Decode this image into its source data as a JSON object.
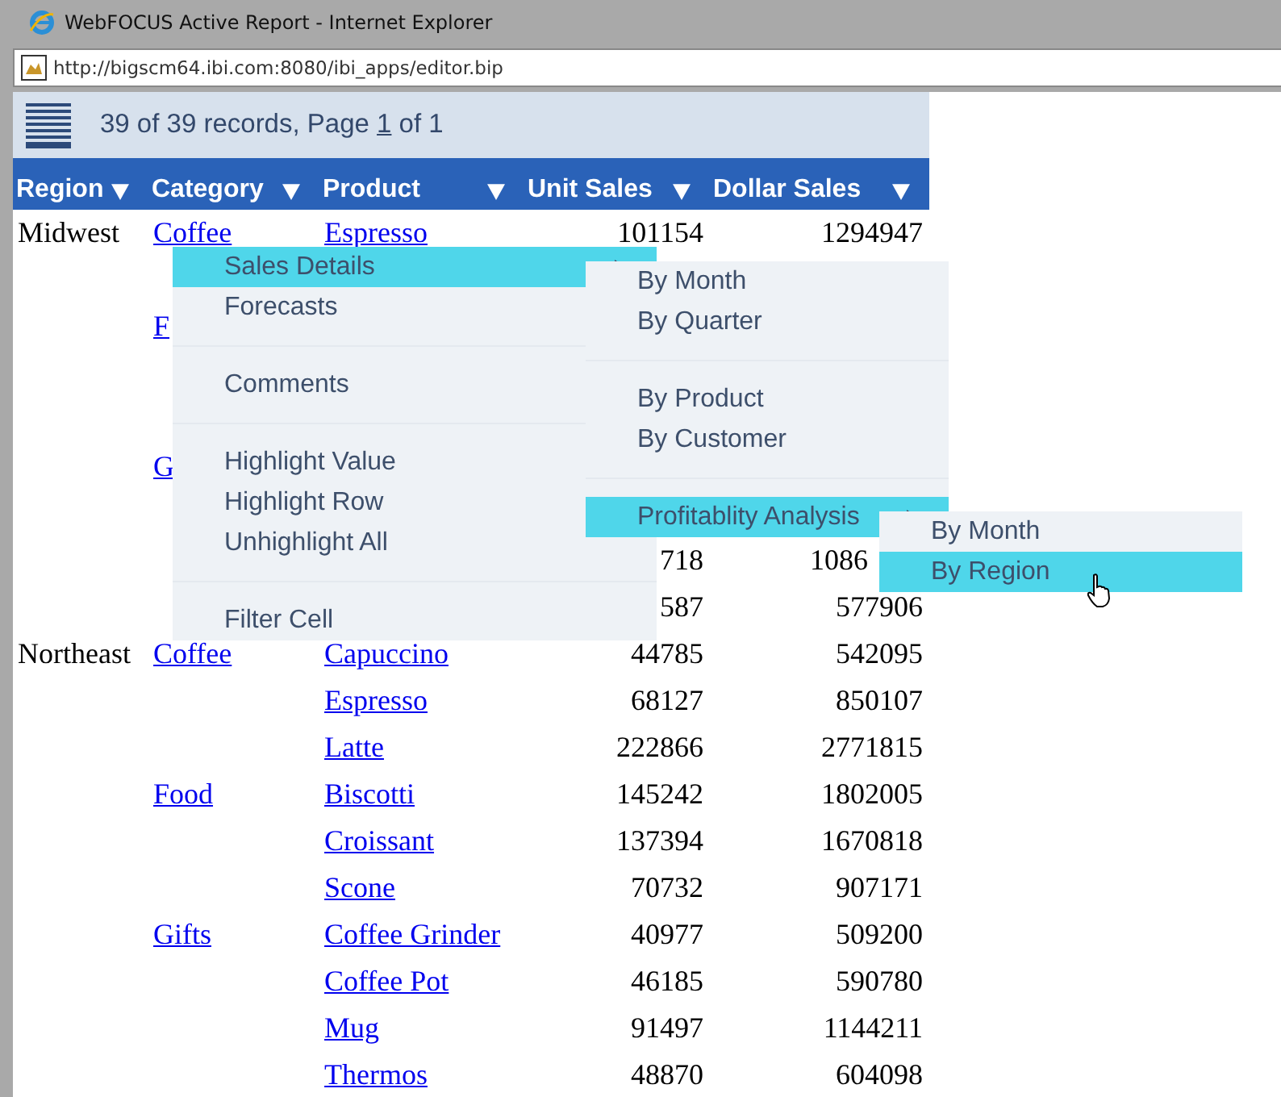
{
  "window": {
    "title": "WebFOCUS Active Report - Internet Explorer",
    "address": "http://bigscm64.ibi.com:8080/ibi_apps/editor.bip"
  },
  "toolbar": {
    "status_parts": [
      "39 of 39 records, Page ",
      "1",
      " of 1"
    ]
  },
  "table": {
    "columns": [
      "Region",
      "Category",
      "Product",
      "Unit Sales",
      "Dollar Sales"
    ],
    "rows": [
      {
        "region": "Midwest",
        "category": "Coffee",
        "product": "Espresso",
        "unit_sales": "101154",
        "dollar_sales": "1294947"
      },
      {},
      {
        "category": "F"
      },
      {},
      {},
      {
        "category": "G"
      },
      {},
      {
        "unit_sales": "718",
        "dollar_sales": "1086",
        "covered_right": true
      },
      {
        "unit_sales": "587",
        "dollar_sales": "577906"
      },
      {
        "region": "Northeast",
        "category": "Coffee",
        "product": "Capuccino",
        "unit_sales": "44785",
        "dollar_sales": "542095"
      },
      {
        "product": "Espresso",
        "unit_sales": "68127",
        "dollar_sales": "850107"
      },
      {
        "product": "Latte",
        "unit_sales": "222866",
        "dollar_sales": "2771815"
      },
      {
        "category": "Food",
        "product": "Biscotti",
        "unit_sales": "145242",
        "dollar_sales": "1802005"
      },
      {
        "product": "Croissant",
        "unit_sales": "137394",
        "dollar_sales": "1670818"
      },
      {
        "product": "Scone",
        "unit_sales": "70732",
        "dollar_sales": "907171"
      },
      {
        "category": "Gifts",
        "product": "Coffee Grinder",
        "unit_sales": "40977",
        "dollar_sales": "509200"
      },
      {
        "product": "Coffee Pot",
        "unit_sales": "46185",
        "dollar_sales": "590780"
      },
      {
        "product": "Mug",
        "unit_sales": "91497",
        "dollar_sales": "1144211"
      },
      {
        "product": "Thermos",
        "unit_sales": "48870",
        "dollar_sales": "604098"
      }
    ]
  },
  "context_menu": {
    "groups": [
      [
        {
          "label": "Sales Details",
          "selected": true,
          "submenu": true
        },
        {
          "label": "Forecasts",
          "selected": false,
          "submenu": false
        }
      ],
      [
        {
          "label": "Comments",
          "selected": false,
          "submenu": false
        }
      ],
      [
        {
          "label": "Highlight Value",
          "selected": false,
          "submenu": false
        },
        {
          "label": "Highlight Row",
          "selected": false,
          "submenu": false
        },
        {
          "label": "Unhighlight All",
          "selected": false,
          "submenu": false
        }
      ],
      [
        {
          "label": "Filter Cell",
          "selected": false,
          "submenu": false
        }
      ]
    ]
  },
  "submenu": {
    "groups": [
      [
        {
          "label": "By Month",
          "selected": false,
          "submenu": false
        },
        {
          "label": "By Quarter",
          "selected": false,
          "submenu": false
        }
      ],
      [
        {
          "label": "By Product",
          "selected": false,
          "submenu": false
        },
        {
          "label": "By Customer",
          "selected": false,
          "submenu": false
        }
      ],
      [
        {
          "label": "Profitablity Analysis",
          "selected": true,
          "submenu": true
        }
      ]
    ]
  },
  "nested_submenu": {
    "groups": [
      [
        {
          "label": "By Month",
          "selected": false,
          "submenu": false
        },
        {
          "label": "By Region",
          "selected": true,
          "submenu": false
        }
      ]
    ]
  }
}
